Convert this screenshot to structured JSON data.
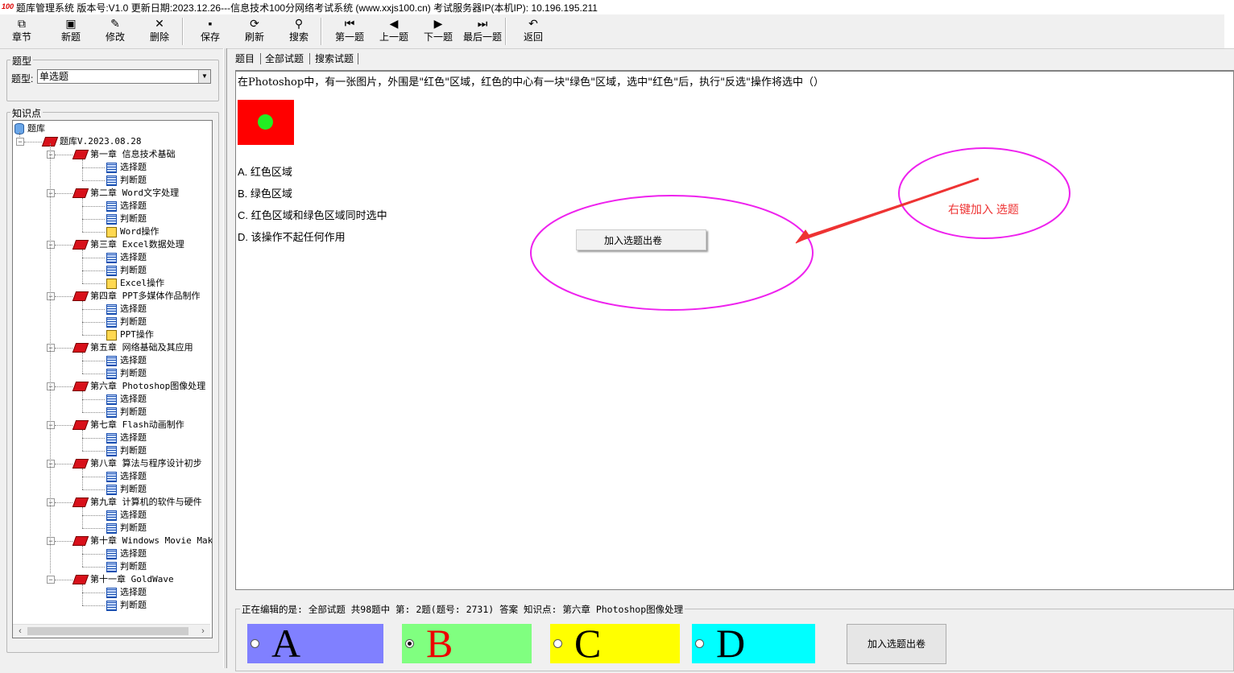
{
  "window": {
    "logo_text": "100",
    "title": "题库管理系统 版本号:V1.0 更新日期:2023.12.26---信息技术100分网络考试系统    (www.xxjs100.cn)      考试服务器IP(本机IP):  10.196.195.211"
  },
  "toolbar": {
    "items": [
      {
        "label": "章节",
        "icon": "chapter-icon",
        "glyph": "⧉"
      },
      {
        "label": "新题",
        "icon": "new-question-icon",
        "glyph": "▣"
      },
      {
        "label": "修改",
        "icon": "edit-icon",
        "glyph": "✎"
      },
      {
        "label": "删除",
        "icon": "delete-icon",
        "glyph": "✕"
      },
      {
        "label": "保存",
        "icon": "save-icon",
        "glyph": "▪"
      },
      {
        "label": "刷新",
        "icon": "refresh-icon",
        "glyph": "⟳"
      },
      {
        "label": "搜索",
        "icon": "search-icon",
        "glyph": "⚲"
      },
      {
        "label": "第一题",
        "icon": "first-icon",
        "glyph": "⏮"
      },
      {
        "label": "上一题",
        "icon": "prev-icon",
        "glyph": "◀"
      },
      {
        "label": "下一题",
        "icon": "next-icon",
        "glyph": "▶"
      },
      {
        "label": "最后一题",
        "icon": "last-icon",
        "glyph": "⏭"
      },
      {
        "label": "返回",
        "icon": "back-icon",
        "glyph": "↶"
      }
    ]
  },
  "sidebar": {
    "type_group": "题型",
    "type_label": "题型:",
    "type_value": "单选题",
    "knowledge_group": "知识点",
    "tree": {
      "root": "题库",
      "version": "题库V.2023.08.28",
      "chapters": [
        {
          "name": "第一章 信息技术基础",
          "children": [
            "选择题",
            "判断题"
          ]
        },
        {
          "name": "第二章 Word文字处理",
          "children": [
            "选择题",
            "判断题",
            "Word操作"
          ]
        },
        {
          "name": "第三章 Excel数据处理",
          "children": [
            "选择题",
            "判断题",
            "Excel操作"
          ]
        },
        {
          "name": "第四章 PPT多媒体作品制作",
          "children": [
            "选择题",
            "判断题",
            "PPT操作"
          ]
        },
        {
          "name": "第五章 网络基础及其应用",
          "children": [
            "选择题",
            "判断题"
          ]
        },
        {
          "name": "第六章 Photoshop图像处理",
          "children": [
            "选择题",
            "判断题"
          ]
        },
        {
          "name": "第七章 Flash动画制作",
          "children": [
            "选择题",
            "判断题"
          ]
        },
        {
          "name": "第八章 算法与程序设计初步",
          "children": [
            "选择题",
            "判断题"
          ]
        },
        {
          "name": "第九章 计算机的软件与硬件",
          "children": [
            "选择题",
            "判断题"
          ]
        },
        {
          "name": "第十章 Windows Movie Make",
          "children": [
            "选择题",
            "判断题"
          ]
        },
        {
          "name": "第十一章 GoldWave",
          "children": [
            "选择题",
            "判断题"
          ]
        }
      ]
    }
  },
  "tabs": [
    "题目",
    "全部试题",
    "搜索试题"
  ],
  "question": {
    "text": "在Photoshop中，有一张图片，外围是\"红色\"区域，红色的中心有一块\"绿色\"区域，选中\"红色\"后，执行\"反选\"操作将选中（）",
    "options": [
      "A. 红色区域",
      "B. 绿色区域",
      "C. 红色区域和绿色区域同时选中",
      "D. 该操作不起任何作用"
    ]
  },
  "context_menu": {
    "item": "加入选题出卷"
  },
  "annotation": {
    "text": "右键加入  选题",
    "color": "#ee3333",
    "ring_color": "#ee22ee"
  },
  "status": {
    "text": "正在编辑的是: 全部试题 共98题中  第: 2题(题号: 2731) 答案 知识点: 第六章 Photoshop图像处理"
  },
  "answers": [
    {
      "letter": "A",
      "bg": "#8080ff",
      "color": "#000000",
      "selected": false
    },
    {
      "letter": "B",
      "bg": "#80ff80",
      "color": "#ee0000",
      "selected": true
    },
    {
      "letter": "C",
      "bg": "#ffff00",
      "color": "#000000",
      "selected": false
    },
    {
      "letter": "D",
      "bg": "#00ffff",
      "color": "#000000",
      "selected": false
    }
  ],
  "add_button": "加入选题出卷",
  "image": {
    "outer_color": "#ff0000",
    "inner_color": "#22ee22"
  }
}
